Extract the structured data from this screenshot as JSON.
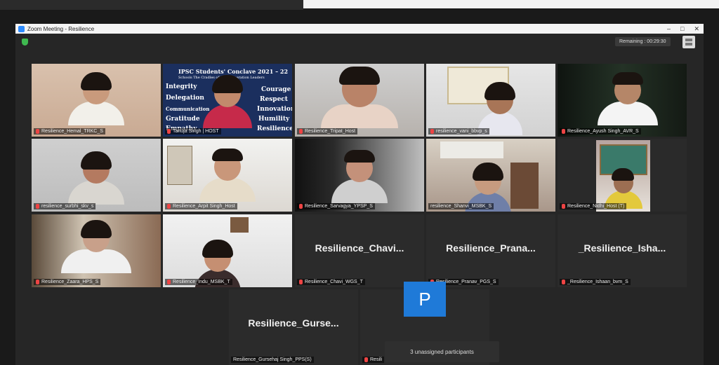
{
  "window": {
    "title": "Zoom Meeting - Resilience",
    "controls": [
      "–",
      "□",
      "✕"
    ]
  },
  "timer": "Remaining : 00:29:30",
  "banner": {
    "title": "IPSC Students' Conclave 2021 – 22",
    "subtitle": "Schools The Cradles of 21st Generation Leaders",
    "left_words": [
      "Integrity",
      "Delegation",
      "Communication",
      "Gratitude",
      "Empathy"
    ],
    "right_words": [
      "Courage",
      "Respect",
      "Innovation",
      "Humility",
      "Resilience"
    ]
  },
  "tiles": [
    {
      "name": "Resilience_Hemal_TRKC_S"
    },
    {
      "name": "Tanuja Singh | HOST"
    },
    {
      "name": "Resilience_Tripat_Host"
    },
    {
      "name": "resilience_vani_bbvp_s"
    },
    {
      "name": "Resilience_Ayush Singh_AVR_S"
    },
    {
      "name": "resilience_surbhi_skv_s"
    },
    {
      "name": "Resilience_Arpit Singh_Host"
    },
    {
      "name": "Resilience_Sarvagya_YPSP_S"
    },
    {
      "name": "resilience_Shanvi_MSBK_S"
    },
    {
      "name": "Resilience_Nidhi_Host (T)"
    },
    {
      "name": "Resilience_Zaara_HPS_S"
    },
    {
      "name": "Resilience_Indu_MSBK_T"
    },
    {
      "name": "Resilience_Chavi_WGS_T",
      "display": "Resilience_Chavi..."
    },
    {
      "name": "Resilience_Pranav_PGS_S",
      "display": "Resilience_Prana..."
    },
    {
      "name": "_Resilience_Ishaan_bvm_S",
      "display": "_Resilience_Isha..."
    },
    {
      "name": "Resilience_Gursehaj Singh_PPS(S)",
      "display": "Resilience_Gurse..."
    },
    {
      "name": "Resili",
      "avatar_letter": "P"
    }
  ],
  "unassigned": "3 unassigned participants"
}
